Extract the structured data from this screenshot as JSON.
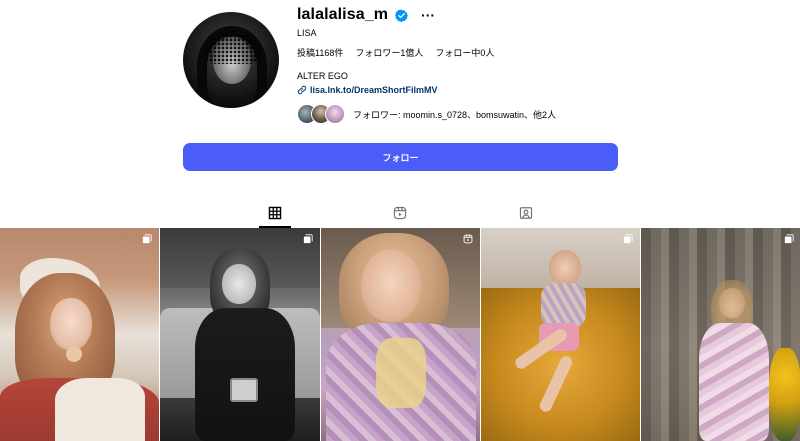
{
  "profile": {
    "username": "lalalalisa_m",
    "verified": true,
    "full_name": "LISA",
    "stats": {
      "posts": "投稿1168件",
      "followers": "フォロワー1億人",
      "following": "フォロー中0人"
    },
    "bio": "ALTER EGO",
    "link": "lisa.lnk.to/DreamShortFilmMV",
    "followed_by": "フォロワー: moomin.s_0728、bomsuwatin、他2人"
  },
  "actions": {
    "follow_label": "フォロー"
  },
  "tabs": [
    {
      "icon": "grid-icon",
      "active": true
    },
    {
      "icon": "reels-icon",
      "active": false
    },
    {
      "icon": "tagged-icon",
      "active": false
    }
  ],
  "posts": [
    {
      "type": "carousel"
    },
    {
      "type": "carousel"
    },
    {
      "type": "reel"
    },
    {
      "type": "carousel"
    },
    {
      "type": "carousel"
    }
  ],
  "colors": {
    "accent": "#4a5df9",
    "verified": "#0095f6",
    "link": "#00376b"
  }
}
